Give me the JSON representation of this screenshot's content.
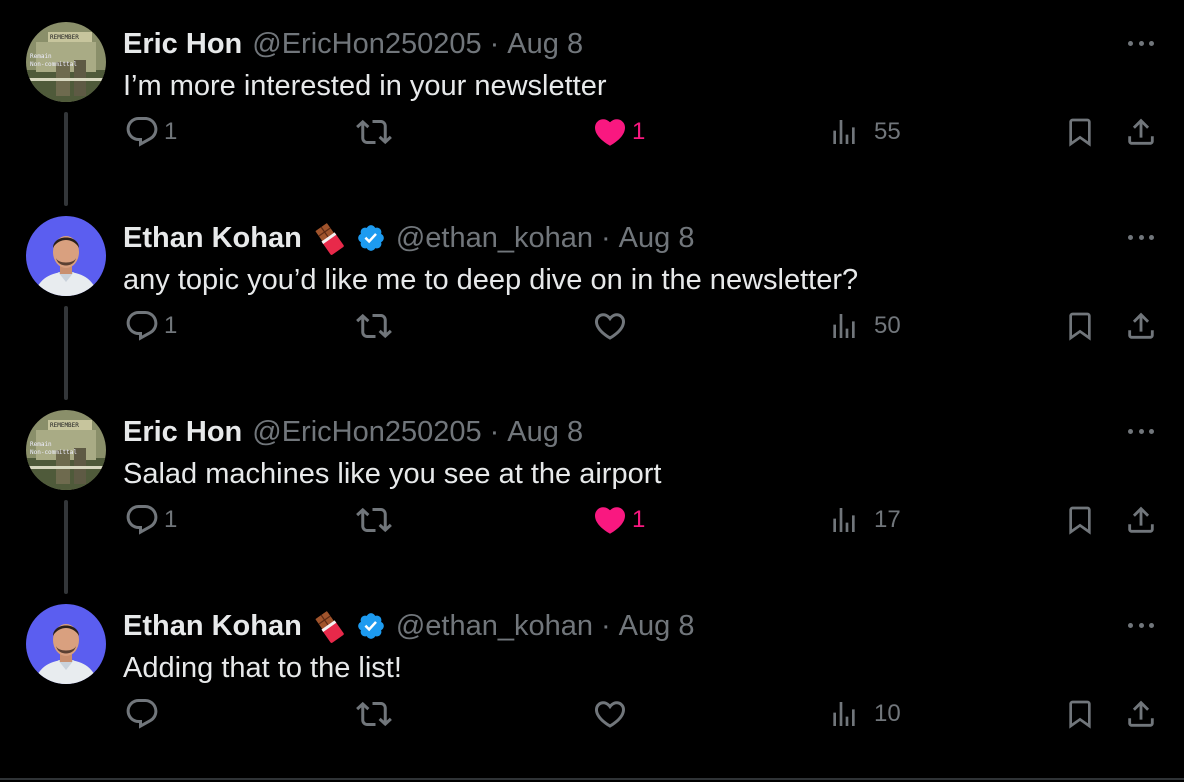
{
  "colors": {
    "background": "#000000",
    "text": "#e7e9ea",
    "muted": "#71767b",
    "like_active": "#f91880",
    "verified": "#1d9bf0"
  },
  "tweets": [
    {
      "name": "Eric Hon",
      "handle": "@EricHon250205",
      "separator": "·",
      "time": "Aug 8",
      "text": "I’m more interested in your newsletter",
      "verified": false,
      "avatar_label_top": "REMEMBER",
      "avatar_label_bottom": "Remain\nNon-committal",
      "replies": "1",
      "retweets": "",
      "likes": "1",
      "liked": true,
      "views": "55"
    },
    {
      "name": "Ethan Kohan",
      "handle": "@ethan_kohan",
      "separator": "·",
      "time": "Aug 8",
      "text": "any topic you’d like me to deep dive on in the newsletter?",
      "verified": true,
      "emoji": "chocolate-bar-icon",
      "replies": "1",
      "retweets": "",
      "likes": "",
      "liked": false,
      "views": "50"
    },
    {
      "name": "Eric Hon",
      "handle": "@EricHon250205",
      "separator": "·",
      "time": "Aug 8",
      "text": "Salad machines like you see at the airport",
      "verified": false,
      "avatar_label_top": "REMEMBER",
      "avatar_label_bottom": "Remain\nNon-committal",
      "replies": "1",
      "retweets": "",
      "likes": "1",
      "liked": true,
      "views": "17"
    },
    {
      "name": "Ethan Kohan",
      "handle": "@ethan_kohan",
      "separator": "·",
      "time": "Aug 8",
      "text": "Adding that to the list!",
      "verified": true,
      "emoji": "chocolate-bar-icon",
      "replies": "",
      "retweets": "",
      "likes": "",
      "liked": false,
      "views": "10"
    }
  ]
}
